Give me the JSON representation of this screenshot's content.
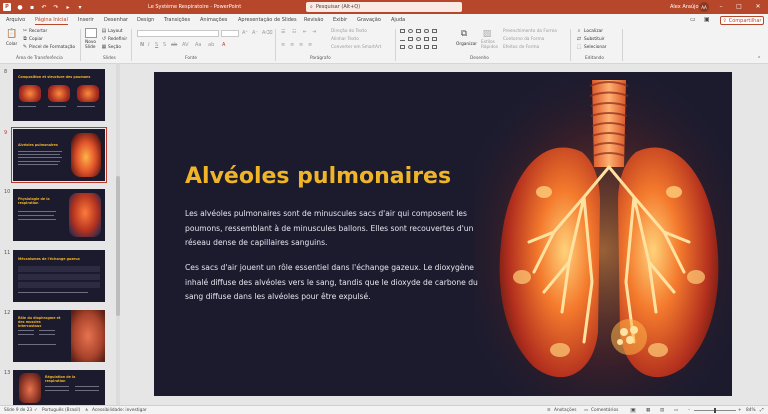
{
  "titlebar": {
    "title": "Le Système Respiratoire  -  PowerPoint",
    "search_placeholder": "Pesquisar (Alt+Q)",
    "user_name": "Alex Araújo",
    "user_initials": "AA"
  },
  "tabs": [
    "Arquivo",
    "Página Inicial",
    "Inserir",
    "Desenhar",
    "Design",
    "Transições",
    "Animações",
    "Apresentação de Slides",
    "Revisão",
    "Exibir",
    "Gravação",
    "Ajuda"
  ],
  "share_label": "Compartilhar",
  "ribbon": {
    "paste": "Colar",
    "cut": "Recortar",
    "copy": "Copiar",
    "format_painter": "Pincel de Formatação",
    "clipboard_group": "Área de Transferência",
    "new_slide": "Novo\nSlide",
    "layout": "Layout",
    "reset": "Redefinir",
    "section": "Seção",
    "slides_group": "Slides",
    "font_group": "Fonte",
    "text_direction": "Direção do Texto",
    "align_text": "Alinhar Texto",
    "convert_smartart": "Converter em SmartArt",
    "paragraph_group": "Parágrafo",
    "arrange": "Organizar",
    "quick_styles": "Estilos\nRápidos",
    "shape_fill": "Preenchimento da Forma",
    "shape_outline": "Contorno da Forma",
    "shape_effects": "Efeitos de Forma",
    "drawing_group": "Desenho",
    "find": "Localizar",
    "replace": "Substituir",
    "select": "Selecionar",
    "editing_group": "Editando"
  },
  "thumbnails": [
    {
      "number": "8",
      "title": "Composition et structure des poumons"
    },
    {
      "number": "9",
      "title": "Alvéoles pulmonaires"
    },
    {
      "number": "10",
      "title": "Physiologie de la respiration"
    },
    {
      "number": "11",
      "title": "Mécanismes de l'échange gazeux"
    },
    {
      "number": "12",
      "title": "Rôle du diaphragme et des muscles intercostaux"
    },
    {
      "number": "13",
      "title": "Régulation de la respiration"
    }
  ],
  "slide": {
    "title": "Alvéoles pulmonaires",
    "paragraph1": "Les alvéoles pulmonaires sont de minuscules sacs d'air qui composent les poumons, ressemblant à de minuscules ballons. Elles sont recouvertes d'un réseau dense de capillaires sanguins.",
    "paragraph2": "Ces sacs d'air jouent un rôle essentiel dans l'échange gazeux. Le dioxygène inhalé diffuse des alvéoles vers le sang, tandis que le dioxyde de carbone du sang diffuse dans les alvéoles pour être expulsé."
  },
  "statusbar": {
    "slide_count": "Slide 9 de 23",
    "language": "Português (Brasil)",
    "accessibility": "Acessibilidade: investigar",
    "notes": "Anotações",
    "comments": "Comentários",
    "zoom": "84%"
  },
  "colors": {
    "accent": "#b7472a",
    "slide_bg": "#1c1b2e",
    "slide_title": "#f0b429"
  }
}
